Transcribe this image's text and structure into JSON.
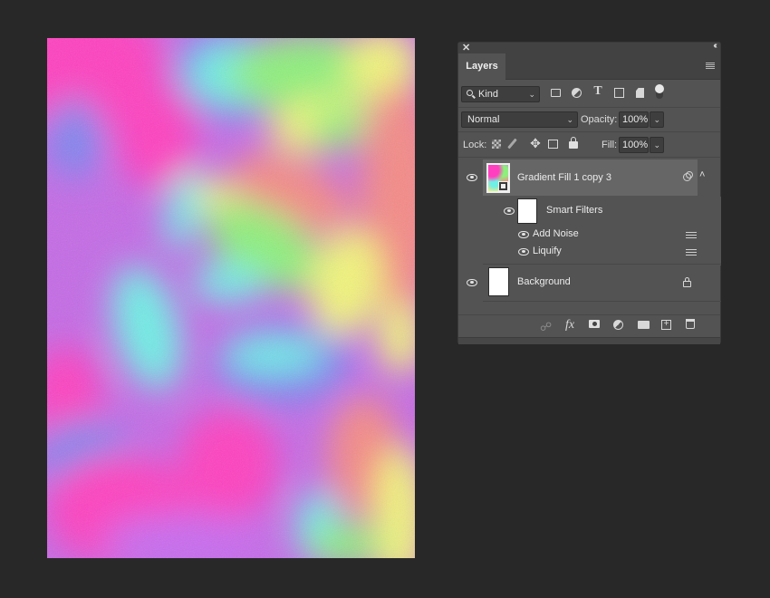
{
  "canvas": {
    "description": "Liquified holographic gradient with noise",
    "palette": {
      "pink": "#ff3fc0",
      "violet": "#c86af0",
      "blue": "#7e86f0",
      "cyan": "#6ff0e6",
      "green": "#8ef07c",
      "yellow": "#f2f57c",
      "salmon": "#f58a86"
    }
  },
  "panel": {
    "close_icon": "✕",
    "collapse_icon": "‹‹",
    "tab_label": "Layers",
    "filter": {
      "kind_label": "Kind",
      "icons": [
        "pixel-layer-filter-icon",
        "adjustment-layer-filter-icon",
        "type-layer-filter-icon",
        "shape-layer-filter-icon",
        "smart-object-filter-icon"
      ],
      "type_glyph": "T"
    },
    "blend_mode": "Normal",
    "opacity_label": "Opacity:",
    "opacity_value": "100%",
    "lock_label": "Lock:",
    "fill_label": "Fill:",
    "fill_value": "100%",
    "layers": [
      {
        "name": "Gradient Fill 1 copy 3",
        "visible": true,
        "selected": true,
        "type": "smart-object",
        "smart_filters": {
          "label": "Smart Filters",
          "visible": true,
          "filters": [
            {
              "name": "Add Noise",
              "visible": true
            },
            {
              "name": "Liquify",
              "visible": true
            }
          ]
        }
      },
      {
        "name": "Background",
        "visible": true,
        "selected": false,
        "locked": true
      }
    ],
    "footer": {
      "fx_label": "fx"
    }
  }
}
